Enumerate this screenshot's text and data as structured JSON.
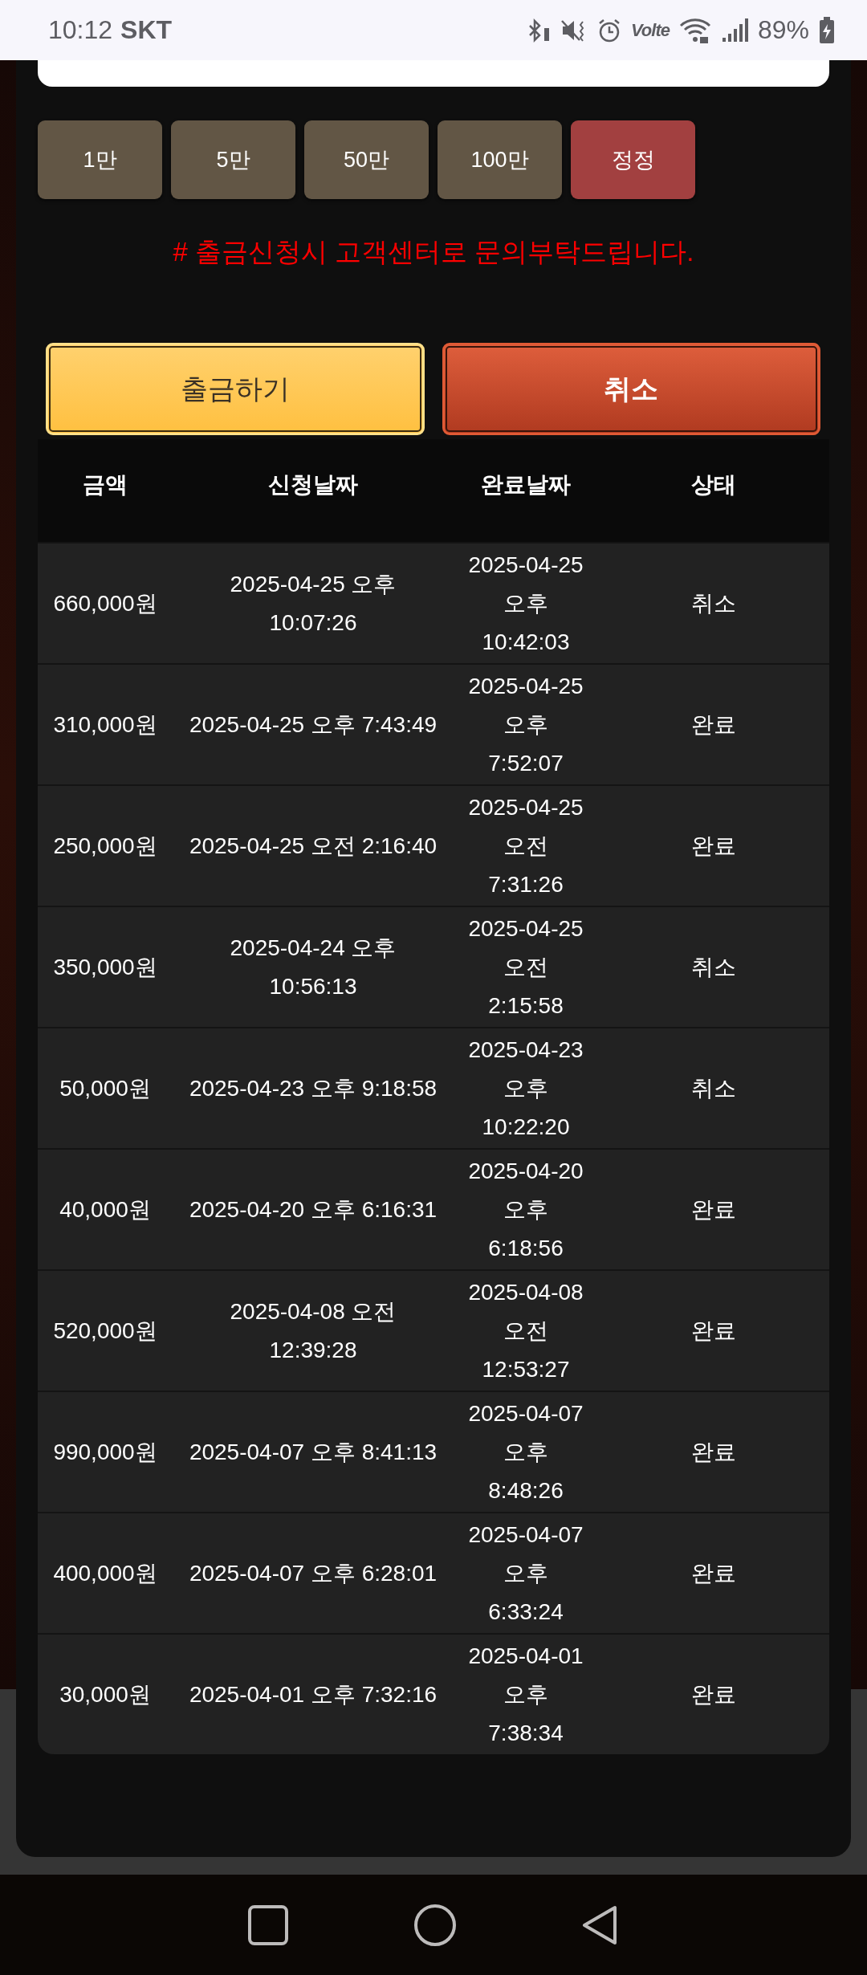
{
  "status_bar": {
    "time": "10:12",
    "carrier": "SKT",
    "network_label": "Volte",
    "battery": "89%"
  },
  "amount_buttons": [
    {
      "label": "1만",
      "kind": "amount"
    },
    {
      "label": "5만",
      "kind": "amount"
    },
    {
      "label": "50만",
      "kind": "amount"
    },
    {
      "label": "100만",
      "kind": "amount"
    },
    {
      "label": "정정",
      "kind": "reset"
    }
  ],
  "notice": "# 출금신청시 고객센터로 문의부탁드립니다.",
  "actions": [
    {
      "label": "출금하기",
      "kind": "submit"
    },
    {
      "label": "취소",
      "kind": "cancel"
    }
  ],
  "table": {
    "columns": [
      "금액",
      "신청날짜",
      "완료날짜",
      "상태"
    ],
    "rows": [
      {
        "amount": "660,000원",
        "requested": "2025-04-25 오후 10:07:26",
        "completed": "2025-04-25 오후 10:42:03",
        "status": "취소"
      },
      {
        "amount": "310,000원",
        "requested": "2025-04-25 오후 7:43:49",
        "completed": "2025-04-25 오후 7:52:07",
        "status": "완료"
      },
      {
        "amount": "250,000원",
        "requested": "2025-04-25 오전 2:16:40",
        "completed": "2025-04-25 오전 7:31:26",
        "status": "완료"
      },
      {
        "amount": "350,000원",
        "requested": "2025-04-24 오후 10:56:13",
        "completed": "2025-04-25 오전 2:15:58",
        "status": "취소"
      },
      {
        "amount": "50,000원",
        "requested": "2025-04-23 오후 9:18:58",
        "completed": "2025-04-23 오후 10:22:20",
        "status": "취소"
      },
      {
        "amount": "40,000원",
        "requested": "2025-04-20 오후 6:16:31",
        "completed": "2025-04-20 오후 6:18:56",
        "status": "완료"
      },
      {
        "amount": "520,000원",
        "requested": "2025-04-08 오전 12:39:28",
        "completed": "2025-04-08 오전 12:53:27",
        "status": "완료"
      },
      {
        "amount": "990,000원",
        "requested": "2025-04-07 오후 8:41:13",
        "completed": "2025-04-07 오후 8:48:26",
        "status": "완료"
      },
      {
        "amount": "400,000원",
        "requested": "2025-04-07 오후 6:28:01",
        "completed": "2025-04-07 오후 6:33:24",
        "status": "완료"
      },
      {
        "amount": "30,000원",
        "requested": "2025-04-01 오후 7:32:16",
        "completed": "2025-04-01 오후 7:38:34",
        "status": "완료"
      }
    ]
  }
}
